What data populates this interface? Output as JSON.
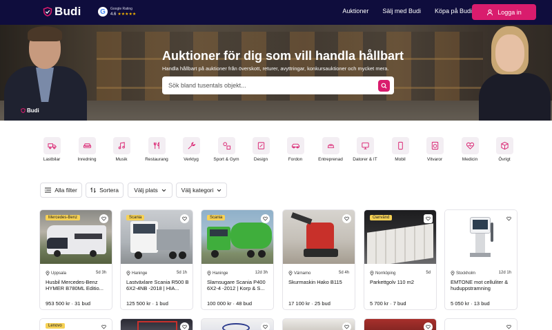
{
  "header": {
    "logo_text": "Budi",
    "google_rating_title": "Google Rating",
    "google_rating_value": "4.6",
    "google_rating_stars": "★★★★★",
    "nav": [
      "Auktioner",
      "Sälj med Budi",
      "Köpa på Budi"
    ],
    "login_label": "Logga in",
    "accent_color": "#d91c6d",
    "bar_color": "#0f0d3d"
  },
  "hero": {
    "title": "Auktioner för dig som vill handla hållbart",
    "subtitle": "Handla hållbart på auktioner från överskott, returer, avyttringar, konkursauktioner och mycket mera.",
    "search_placeholder": "Sök bland tusentals objekt...",
    "watermark": "Budi"
  },
  "categories": [
    {
      "label": "Lastbilar",
      "icon": "truck-icon"
    },
    {
      "label": "Inredning",
      "icon": "sofa-icon"
    },
    {
      "label": "Musik",
      "icon": "music-note-icon"
    },
    {
      "label": "Restaurang",
      "icon": "cutlery-icon"
    },
    {
      "label": "Verktyg",
      "icon": "wrench-icon"
    },
    {
      "label": "Sport & Gym",
      "icon": "sport-icon"
    },
    {
      "label": "Design",
      "icon": "design-icon"
    },
    {
      "label": "Fordon",
      "icon": "car-icon"
    },
    {
      "label": "Entreprenad",
      "icon": "excavator-icon"
    },
    {
      "label": "Datorer & IT",
      "icon": "computer-icon"
    },
    {
      "label": "Mobil",
      "icon": "mobile-icon"
    },
    {
      "label": "Vitvaror",
      "icon": "washer-icon"
    },
    {
      "label": "Medicin",
      "icon": "heart-pulse-icon"
    },
    {
      "label": "Övrigt",
      "icon": "box-icon"
    }
  ],
  "filters": {
    "all_filters": "Alla filter",
    "sort": "Sortera",
    "location": "Välj plats",
    "category": "Välj kategori"
  },
  "listings": [
    {
      "badge": "Mercedes-Benz",
      "location": "Uppsala",
      "time": "5d 3h",
      "title": "Husbil Mercedes-Benz HYMER B780ML Editio...",
      "price": "953 500 kr · 31 bud"
    },
    {
      "badge": "Scania",
      "location": "Haninge",
      "time": "5d 1h",
      "title": "Lastväxlare Scania R500 B 6X2-4NB -2018 | HIA...",
      "price": "125 500 kr · 1 bud"
    },
    {
      "badge": "Scania",
      "location": "Haninge",
      "time": "12d 3h",
      "title": "Slamsugare Scania P400 6X2-4 -2012 | Korp & S...",
      "price": "100 000 kr · 48 bud"
    },
    {
      "badge": "",
      "location": "Värnamo",
      "time": "5d 4h",
      "title": "Skurmaskin Hako B115",
      "price": "17 100 kr · 25 bud"
    },
    {
      "badge": "Oanvänd",
      "location": "Norrköping",
      "time": "5d",
      "title": "Parkettgolv 110 m2",
      "price": "5 700 kr · 7 bud"
    },
    {
      "badge": "",
      "location": "Stockholm",
      "time": "12d 1h",
      "title": "EMTONE mot celluliter & hudupps­tramning",
      "price": "5 050 kr · 13 bud"
    }
  ],
  "listings_row2": [
    {
      "badge": "Lenovo"
    },
    {
      "badge": ""
    },
    {
      "badge": ""
    },
    {
      "badge": ""
    },
    {
      "badge": ""
    },
    {
      "badge": ""
    }
  ]
}
